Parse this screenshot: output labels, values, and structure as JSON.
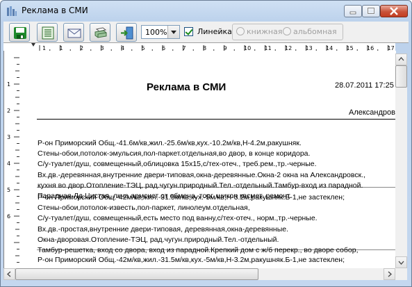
{
  "window": {
    "title": "Реклама в СМИ"
  },
  "toolbar": {
    "buttons": [
      "save-icon",
      "list-icon",
      "mail-icon",
      "print-icon",
      "exit-icon"
    ],
    "zoom": "100%",
    "ruler_checked": true,
    "ruler_label": "Линейка",
    "orientation": {
      "portrait": "книжная",
      "landscape": "альбомная"
    }
  },
  "ruler": {
    "h_numbers": [
      "1",
      "1",
      "2",
      "3",
      "4",
      "5",
      "6",
      "7",
      "8",
      "9",
      "10",
      "11",
      "12",
      "13",
      "14",
      "15",
      "16",
      "17"
    ],
    "v_numbers": [
      "1",
      "2",
      "3",
      "4",
      "5",
      "6"
    ]
  },
  "document": {
    "title": "Реклама в СМИ",
    "date": "28.07.2011 17:25",
    "address": "Александров",
    "records": [
      {
        "lines": [
          "Р-он Приморский Общ.-41.6м/кв,жил.-25.6м/кв,кух.-10.2м/кв,Н-4.2м,ракушняк.",
          "Стены-обои,потолок-эмульсия,пол-паркет.отдельная,во двор, в конце коридора.",
          "С/у-туалет/душ, совмещенный,облицовка 15х15,с/тех-отеч., треб.рем.,тр.-черные.",
          "Вх.дв.-деревянная,внутренние двери-типовая,окна-деревянные.Окна-2 окна на Александровск.,",
          "кухня во двор.Отопление-ТЭЦ, рад.чугун.природный.Тел.-отдельный.Тамбур-вход из парадной.",
          "Парадная-Лд.Цистая, лкна армсист от обмена, торг. шикон квсмет. ремонт."
        ]
      },
      {
        "lines": [
          "Р-он Приморский Общ.-42м/кв,жил.-31.5м/кв,кух.-5м/кв,Н-3.2м,ракушняк.Б-1,не застеклен;",
          "Стены-обои,потолок-известь,пол-паркет, линолеум.отдельная,",
          "С/у-туалет/душ, совмещенный,есть место под ванну,с/тех-отеч., норм.,тр.-черные.",
          "Вх.дв.-простая,внутренние двери-типовая, деревянная,окна-деревянные.",
          "Окна-дворовая.Отопление-ТЭЦ, рад.чугун.природный.Тел.-отдельный.",
          "Тамбур-решетка, вход со двора, вход из парадной.Крепкий дом с ж/б перекр., во дворе собор,"
        ]
      },
      {
        "lines": [
          "Р-он Приморский Общ.-42м/кв,жил.-31.5м/кв,кух.-5м/кв,Н-3.2м,ракушняк.Б-1,не застеклен;"
        ]
      }
    ]
  }
}
